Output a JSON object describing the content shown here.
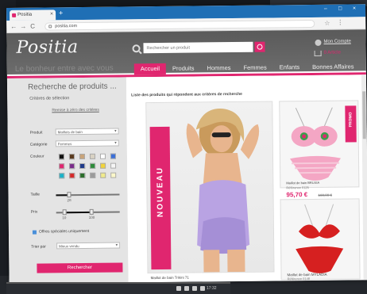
{
  "browser": {
    "tab_title": "Positia",
    "new_tab": "+",
    "tab_close": "×",
    "minimize": "–",
    "maximize": "□",
    "close": "×",
    "back": "←",
    "forward": "→",
    "reload": "C",
    "url": "positia.com",
    "bookmark_star": "☆",
    "menu_dots": "⋮"
  },
  "header": {
    "logo": "Positia",
    "slogan": "Le bonheur entre avec vous",
    "search_placeholder": "Rechercher un produit",
    "account_link": "Mon Compte",
    "cart_link": "0 Article"
  },
  "nav": {
    "items": [
      {
        "label": "Accueil",
        "active": true
      },
      {
        "label": "Produits",
        "active": false
      },
      {
        "label": "Hommes",
        "active": false
      },
      {
        "label": "Femmes",
        "active": false
      },
      {
        "label": "Enfants",
        "active": false
      },
      {
        "label": "Bonnes Affaires",
        "active": false
      }
    ]
  },
  "sidebar": {
    "title": "Recherche de produits ...",
    "subtitle": "Critères de sélection",
    "reset_link": "Remise à zéro des critères",
    "product_label": "Produit",
    "product_value": "Maillots de bain",
    "category_label": "Catégorie",
    "category_value": "Femmes",
    "color_label": "Couleur",
    "colors": [
      "#111111",
      "#5a3b1e",
      "#c8a37a",
      "#d9d2c3",
      "#ffffff",
      "#3a6fd8",
      "#e0266f",
      "#7a2a8a",
      "#1f3a8a",
      "#2d8c3a",
      "#f2d43a",
      "#f5f5f5",
      "#1ab3c9",
      "#d62828",
      "#2b6e2b",
      "#9b9b9b",
      "#f0ea8a",
      "#fbf7c9"
    ],
    "size_label": "Taille",
    "size_value": "28",
    "size_fraction": 0.2,
    "price_label": "Prix",
    "price_min": "10",
    "price_max": "100",
    "price_fraction_min": 0.12,
    "price_fraction_max": 0.55,
    "offers_label": "Offres spéciales uniquement",
    "sort_label": "Trier par",
    "sort_value": "Mieux vendu",
    "search_button": "Rechercher"
  },
  "main": {
    "title": "Liste des produits qui répondent aux critères de recherche",
    "hero_banner": "NOUVEAU",
    "hero_caption": "Maillot de bain Trikini 71",
    "product1": {
      "name": "Maillot de bain BRUXIA",
      "ref": "Référence 0125",
      "tag": "PROMO",
      "price": "95,70 €",
      "old_price": "108,00 €"
    },
    "product2": {
      "name": "Maillot de bain MYLADIA",
      "ref": "Référence 0148"
    }
  },
  "taskbar": {
    "clock": "17:32"
  }
}
